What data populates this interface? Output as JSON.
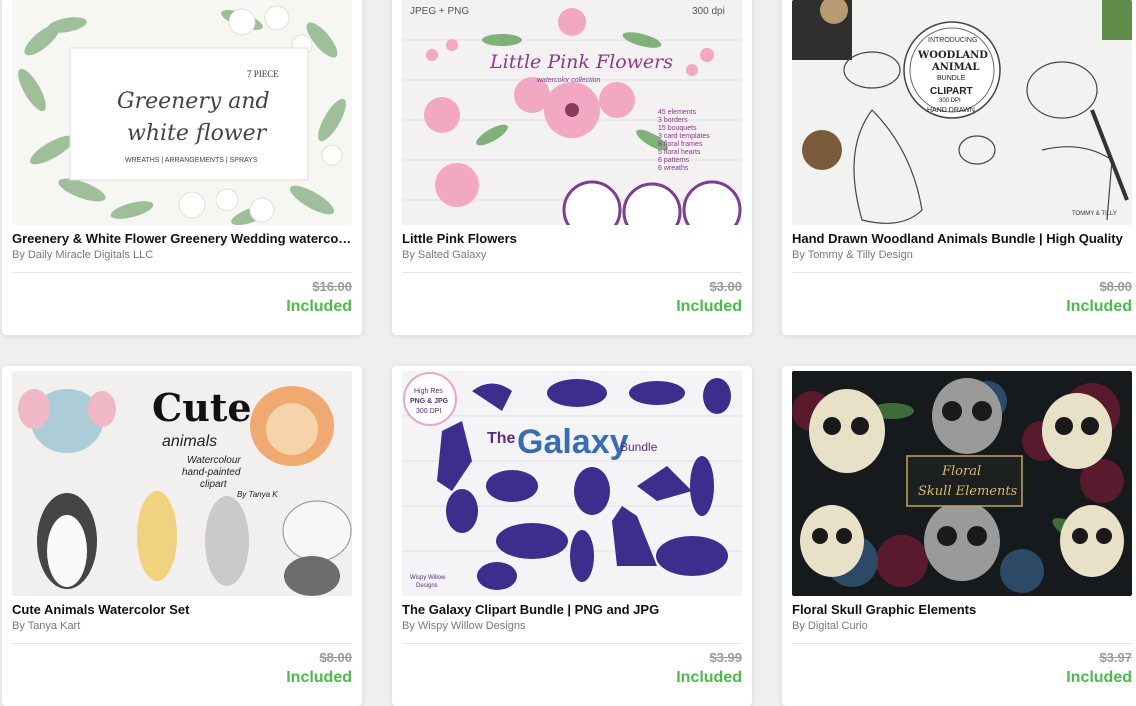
{
  "products": [
    {
      "title": "Greenery & White Flower Greenery Wedding watercolor",
      "author": "By Daily Miracle Digitals LLC",
      "price": "$16.00",
      "status": "Included",
      "thumb_text": {
        "count": "7 PIECE",
        "line1": "Greenery and",
        "line2": "white flower",
        "sub": "WREATHS | ARRANGEMENTS | SPRAYS"
      }
    },
    {
      "title": "Little Pink Flowers",
      "author": "By Salted Galaxy",
      "price": "$3.00",
      "status": "Included",
      "thumb_text": {
        "left": "JPEG + PNG",
        "right": "300 dpi",
        "line1": "Little Pink Flowers",
        "line2": "watercolor collection",
        "list": [
          "45 elements",
          "3 borders",
          "15 bouquets",
          "3 card templates",
          "8 floral frames",
          "5 floral hearts",
          "6 patterns",
          "6 wreaths"
        ]
      }
    },
    {
      "title": "Hand Drawn Woodland Animals Bundle | High Quality",
      "author": "By Tommy & Tilly Design",
      "price": "$8.00",
      "status": "Included",
      "thumb_text": {
        "intro": "INTRODUCING",
        "line1": "WOODLAND",
        "line2": "ANIMAL",
        "line3": "BUNDLE",
        "clip": "CLIPART",
        "dpi": "300 DPI",
        "hand": "HAND DRAWN",
        "brand": "TOMMY & TILLY"
      }
    },
    {
      "title": "Cute Animals Watercolor Set",
      "author": "By Tanya Kart",
      "price": "$8.00",
      "status": "Included",
      "thumb_text": {
        "line1": "Cute",
        "line2": "animals",
        "line3": "Watercolour",
        "line4": "hand-painted",
        "line5": "clipart",
        "by": "By Tanya K"
      }
    },
    {
      "title": "The Galaxy Clipart Bundle | PNG and JPG",
      "author": "By Wispy Willow Designs",
      "price": "$3.99",
      "status": "Included",
      "thumb_text": {
        "badge1": "High Res",
        "badge2": "PNG & JPG",
        "badge3": "300 DPI",
        "the": "The",
        "galaxy": "Galaxy",
        "bundle": "Bundle",
        "logo1": "Wispy Willow",
        "logo2": "Designs"
      }
    },
    {
      "title": "Floral Skull Graphic Elements",
      "author": "By Digital Curio",
      "price": "$3.97",
      "status": "Included",
      "thumb_text": {
        "line1": "Floral",
        "line2": "Skull Elements"
      }
    }
  ]
}
